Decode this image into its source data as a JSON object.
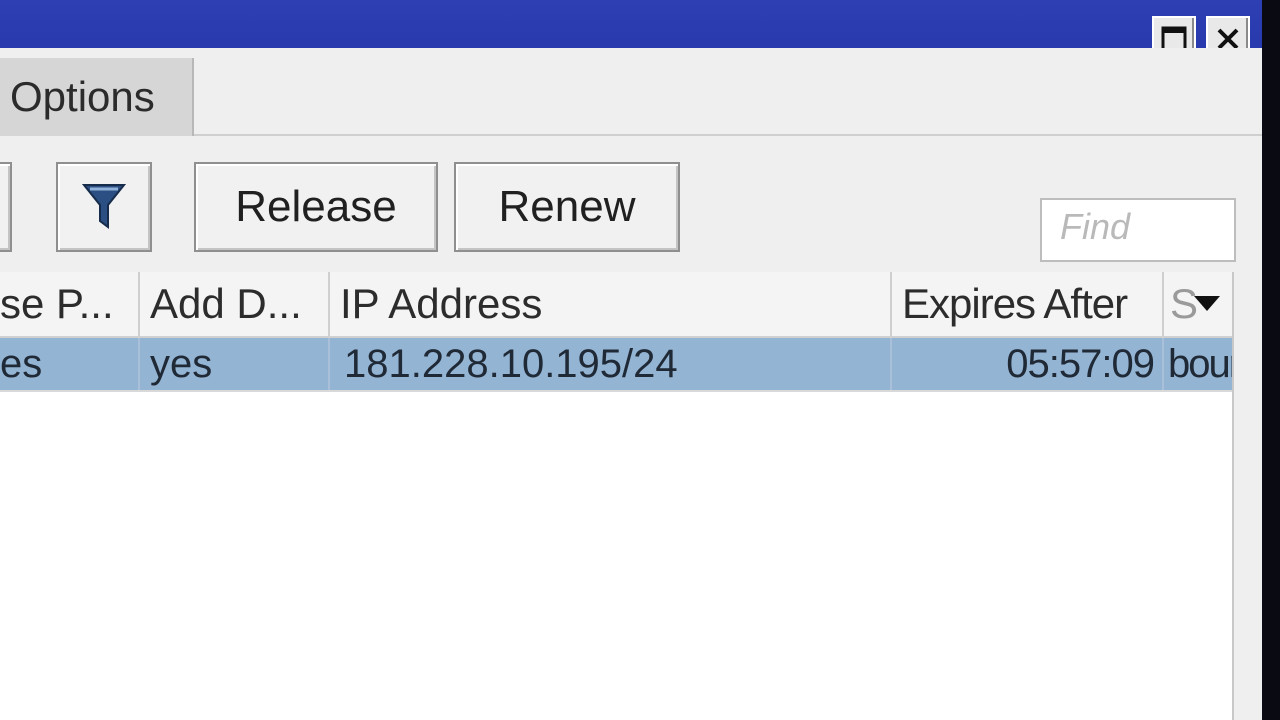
{
  "window": {
    "maximize_icon": "maximize-icon",
    "close_icon": "close-icon"
  },
  "tabs": [
    {
      "label": "Options"
    }
  ],
  "toolbar": {
    "filter_icon": "filter-icon",
    "release_label": "Release",
    "renew_label": "Renew",
    "find_placeholder": "Find"
  },
  "table": {
    "columns": [
      "se P...",
      "Add D...",
      "IP Address",
      "Expires After",
      "S"
    ],
    "menu_icon": "column-menu-down-icon",
    "rows": [
      {
        "c0": "es",
        "c1": "yes",
        "ip": "181.228.10.195/24",
        "expires": "05:57:09",
        "status": "bour"
      }
    ]
  }
}
